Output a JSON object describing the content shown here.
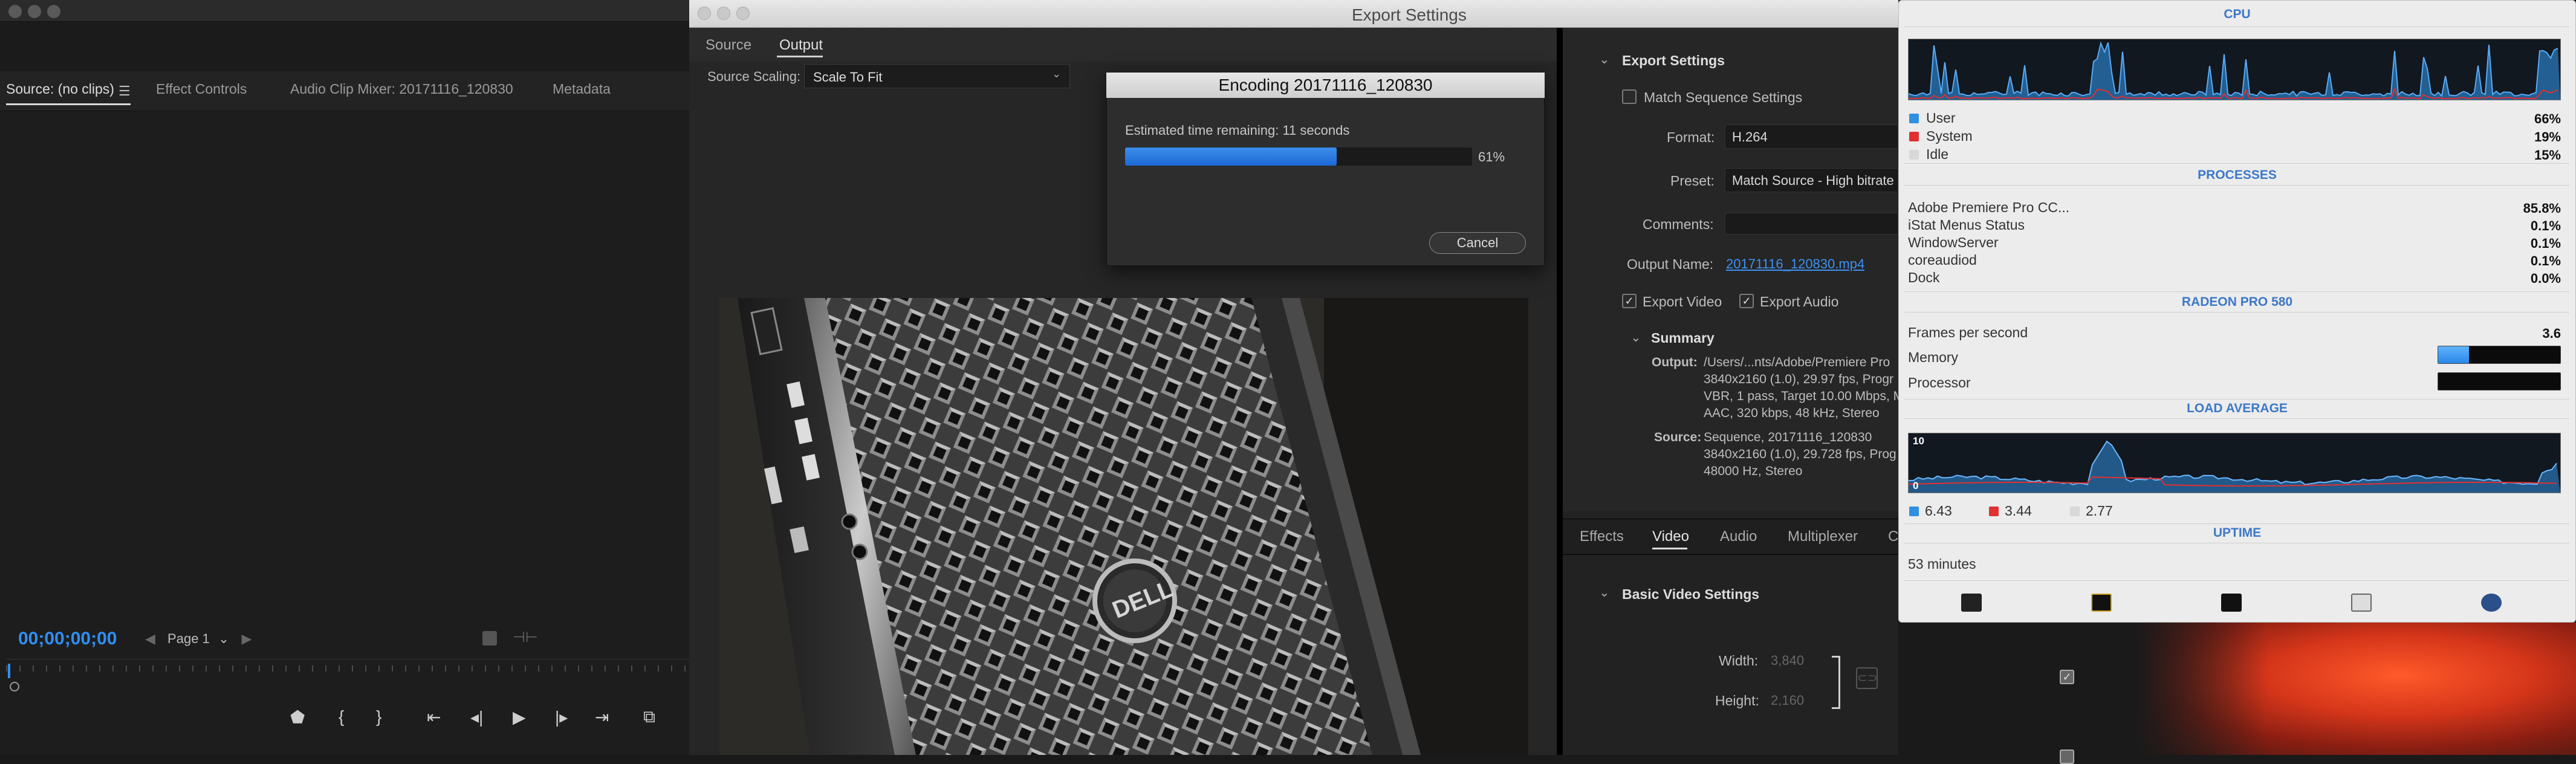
{
  "premiere": {
    "tabs": [
      "Source: (no clips)",
      "Effect Controls",
      "Audio Clip Mixer: 20171116_120830",
      "Metadata"
    ],
    "timecode": "00;00;00;00",
    "page": "Page 1"
  },
  "export_window": {
    "title": "Export Settings",
    "tabs": [
      "Source",
      "Output"
    ],
    "source_scaling_label": "Source Scaling:",
    "source_scaling_value": "Scale To Fit",
    "encoding": {
      "title": "Encoding 20171116_120830",
      "estimate": "Estimated time remaining: 11 seconds",
      "progress_fraction": 0.61,
      "progress_text": "61%",
      "cancel": "Cancel"
    },
    "settings": {
      "header": "Export Settings",
      "match_sequence": "Match Sequence Settings",
      "format_label": "Format:",
      "format_value": "H.264",
      "preset_label": "Preset:",
      "preset_value": "Match Source - High bitrate",
      "comments_label": "Comments:",
      "output_name_label": "Output Name:",
      "output_name_value": "20171116_120830.mp4",
      "export_video": "Export Video",
      "export_audio": "Export Audio",
      "summary_header": "Summary",
      "summary_output_label": "Output:",
      "summary_output_lines": [
        "/Users/...nts/Adobe/Premiere Pro",
        "3840x2160 (1.0), 29.97 fps, Progr",
        "VBR, 1 pass, Target 10.00 Mbps, M",
        "AAC, 320 kbps, 48 kHz, Stereo"
      ],
      "summary_source_label": "Source:",
      "summary_source_lines": [
        "Sequence, 20171116_120830",
        "3840x2160 (1.0), 29.728 fps, Prog",
        "48000 Hz, Stereo"
      ]
    },
    "video_tabs": [
      "Effects",
      "Video",
      "Audio",
      "Multiplexer",
      "C"
    ],
    "basic_video": "Basic Video Settings",
    "width_label": "Width:",
    "width_value": "3,840",
    "height_label": "Height:",
    "height_value": "2,160"
  },
  "istat": {
    "cpu_header": "CPU",
    "user_label": "User",
    "user_value": "66%",
    "system_label": "System",
    "system_value": "19%",
    "idle_label": "Idle",
    "idle_value": "15%",
    "processes_header": "PROCESSES",
    "processes": [
      {
        "name": "Adobe Premiere Pro CC...",
        "value": "85.8%"
      },
      {
        "name": "iStat Menus Status",
        "value": "0.1%"
      },
      {
        "name": "WindowServer",
        "value": "0.1%"
      },
      {
        "name": "coreaudiod",
        "value": "0.1%"
      },
      {
        "name": "Dock",
        "value": "0.0%"
      }
    ],
    "gpu_header": "RADEON PRO 580",
    "fps_label": "Frames per second",
    "fps_value": "3.6",
    "memory_label": "Memory",
    "memory_fraction": 0.25,
    "processor_label": "Processor",
    "processor_fraction": 0.0,
    "load_header": "LOAD AVERAGE",
    "load_max": "10",
    "load_min": "0",
    "load_1": "6.43",
    "load_5": "3.44",
    "load_15": "2.77",
    "uptime_header": "UPTIME",
    "uptime_value": "53 minutes",
    "colors": {
      "user": "#2f8fe0",
      "system": "#e03030",
      "idle": "#d8d8d8",
      "header": "#3c78c8"
    }
  }
}
